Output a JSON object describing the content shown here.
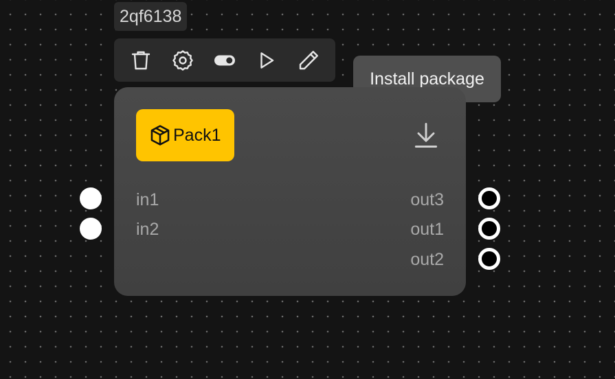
{
  "node": {
    "id": "2qf6138",
    "package_label": "Pack1",
    "inputs": [
      "in1",
      "in2"
    ],
    "outputs": [
      "out3",
      "out1",
      "out2"
    ]
  },
  "toolbar": {
    "buttons": [
      "trash-icon",
      "gear-icon",
      "toggle-icon",
      "play-icon",
      "pencil-icon"
    ]
  },
  "tooltip": {
    "text": "Install package"
  },
  "colors": {
    "canvas": "#141414",
    "card": "#444444",
    "badge": "#ffc400",
    "toolbar": "#2b2b2b",
    "tooltip": "#4f4f4f"
  }
}
